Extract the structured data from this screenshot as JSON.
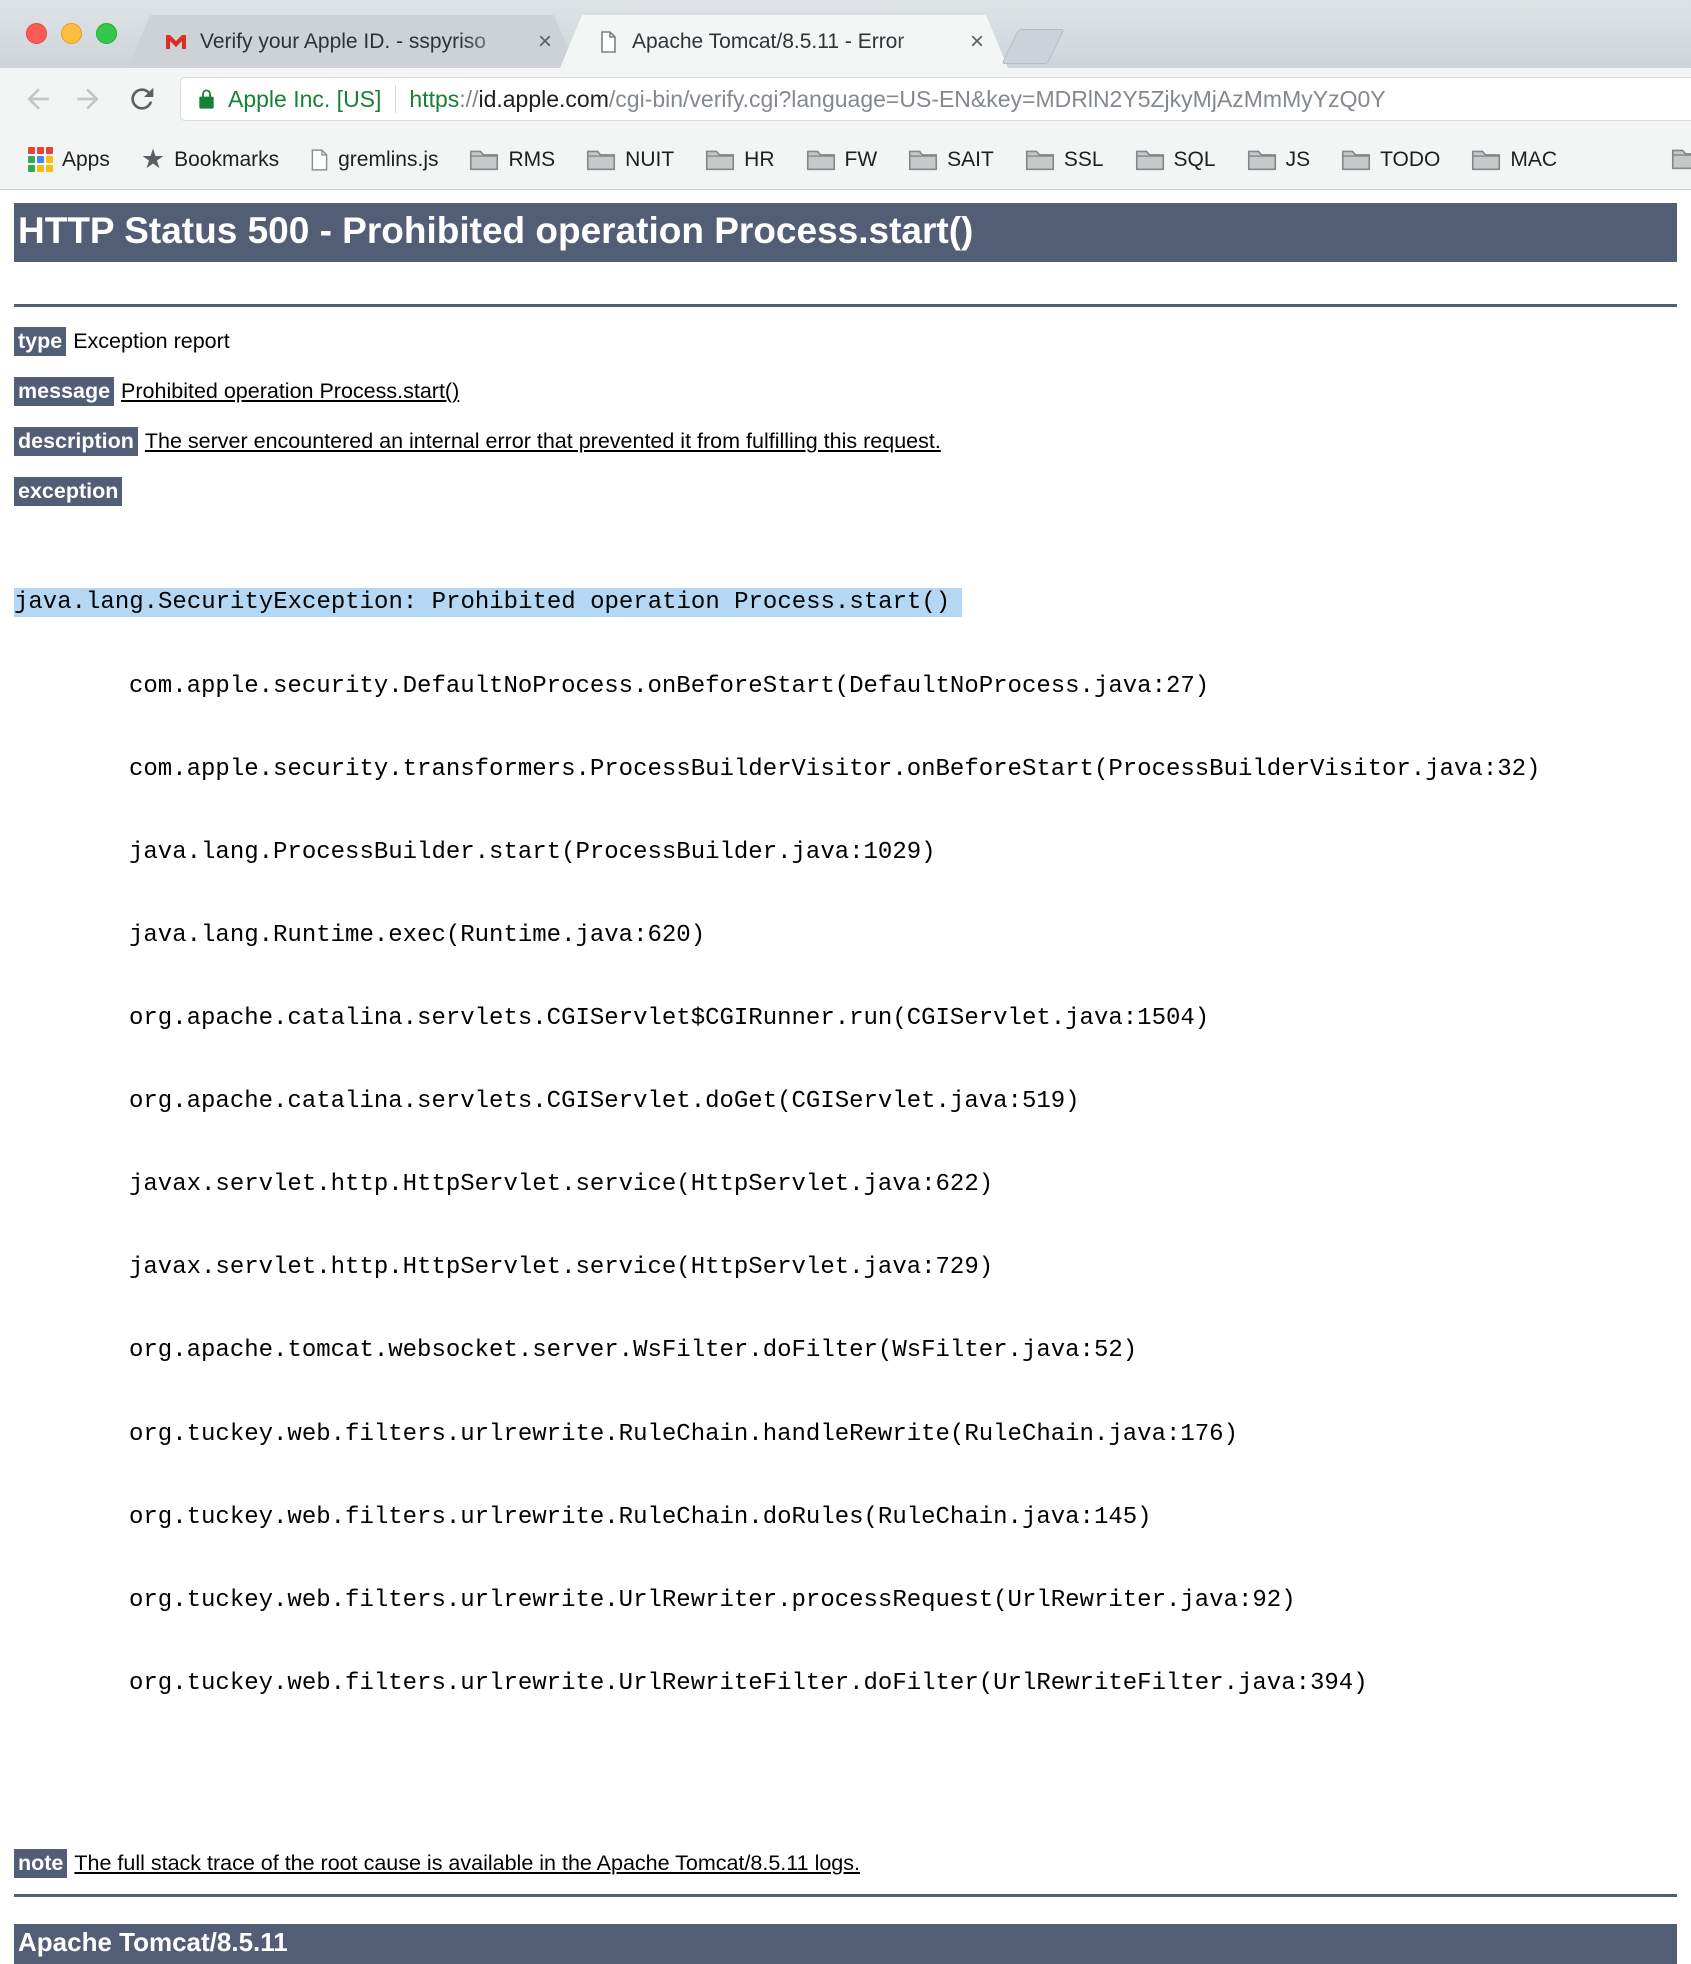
{
  "browser": {
    "traffic_lights": [
      "close",
      "minimize",
      "zoom"
    ],
    "tabs": [
      {
        "title": "Verify your Apple ID. - sspyriso",
        "favicon": "gmail",
        "close_glyph": "×",
        "active": false
      },
      {
        "title": "Apache Tomcat/8.5.11 - Error",
        "favicon": "document",
        "close_glyph": "×",
        "active": true
      }
    ],
    "address_bar": {
      "ev_label": "Apple Inc. [US]",
      "scheme": "https",
      "separator": "://",
      "host": "id.apple.com",
      "path": "/cgi-bin/verify.cgi?language=US-EN&key=MDRlN2Y5ZjkyMjAzMmMyYzQ0Y"
    },
    "bookmarks_bar": {
      "apps_label": "Apps",
      "bookmarks_label": "Bookmarks",
      "page_bookmark": "gremlins.js",
      "folders": [
        "RMS",
        "NUIT",
        "HR",
        "FW",
        "SAIT",
        "SSL",
        "SQL",
        "JS",
        "TODO",
        "MAC"
      ]
    }
  },
  "page": {
    "title": "HTTP Status 500 - Prohibited operation Process.start()",
    "fields": [
      {
        "label": "type",
        "value": "Exception report"
      },
      {
        "label": "message",
        "value": "Prohibited operation Process.start()"
      },
      {
        "label": "description",
        "value": "The server encountered an internal error that prevented it from fulfilling this request."
      }
    ],
    "exception_label": "exception",
    "stack": {
      "exception_line": "java.lang.SecurityException: Prohibited operation Process.start()",
      "frames": [
        "com.apple.security.DefaultNoProcess.onBeforeStart(DefaultNoProcess.java:27)",
        "com.apple.security.transformers.ProcessBuilderVisitor.onBeforeStart(ProcessBuilderVisitor.java:32)",
        "java.lang.ProcessBuilder.start(ProcessBuilder.java:1029)",
        "java.lang.Runtime.exec(Runtime.java:620)",
        "org.apache.catalina.servlets.CGIServlet$CGIRunner.run(CGIServlet.java:1504)",
        "org.apache.catalina.servlets.CGIServlet.doGet(CGIServlet.java:519)",
        "javax.servlet.http.HttpServlet.service(HttpServlet.java:622)",
        "javax.servlet.http.HttpServlet.service(HttpServlet.java:729)",
        "org.apache.tomcat.websocket.server.WsFilter.doFilter(WsFilter.java:52)",
        "org.tuckey.web.filters.urlrewrite.RuleChain.handleRewrite(RuleChain.java:176)",
        "org.tuckey.web.filters.urlrewrite.RuleChain.doRules(RuleChain.java:145)",
        "org.tuckey.web.filters.urlrewrite.UrlRewriter.processRequest(UrlRewriter.java:92)",
        "org.tuckey.web.filters.urlrewrite.UrlRewriteFilter.doFilter(UrlRewriteFilter.java:394)"
      ]
    },
    "note_label": "note",
    "note_value": "The full stack trace of the root cause is available in the Apache Tomcat/8.5.11 logs.",
    "footer": "Apache Tomcat/8.5.11"
  },
  "colors": {
    "tomcat_bar": "#525D76",
    "selection_highlight": "#b4d7f3",
    "secure_green": "#188038"
  }
}
